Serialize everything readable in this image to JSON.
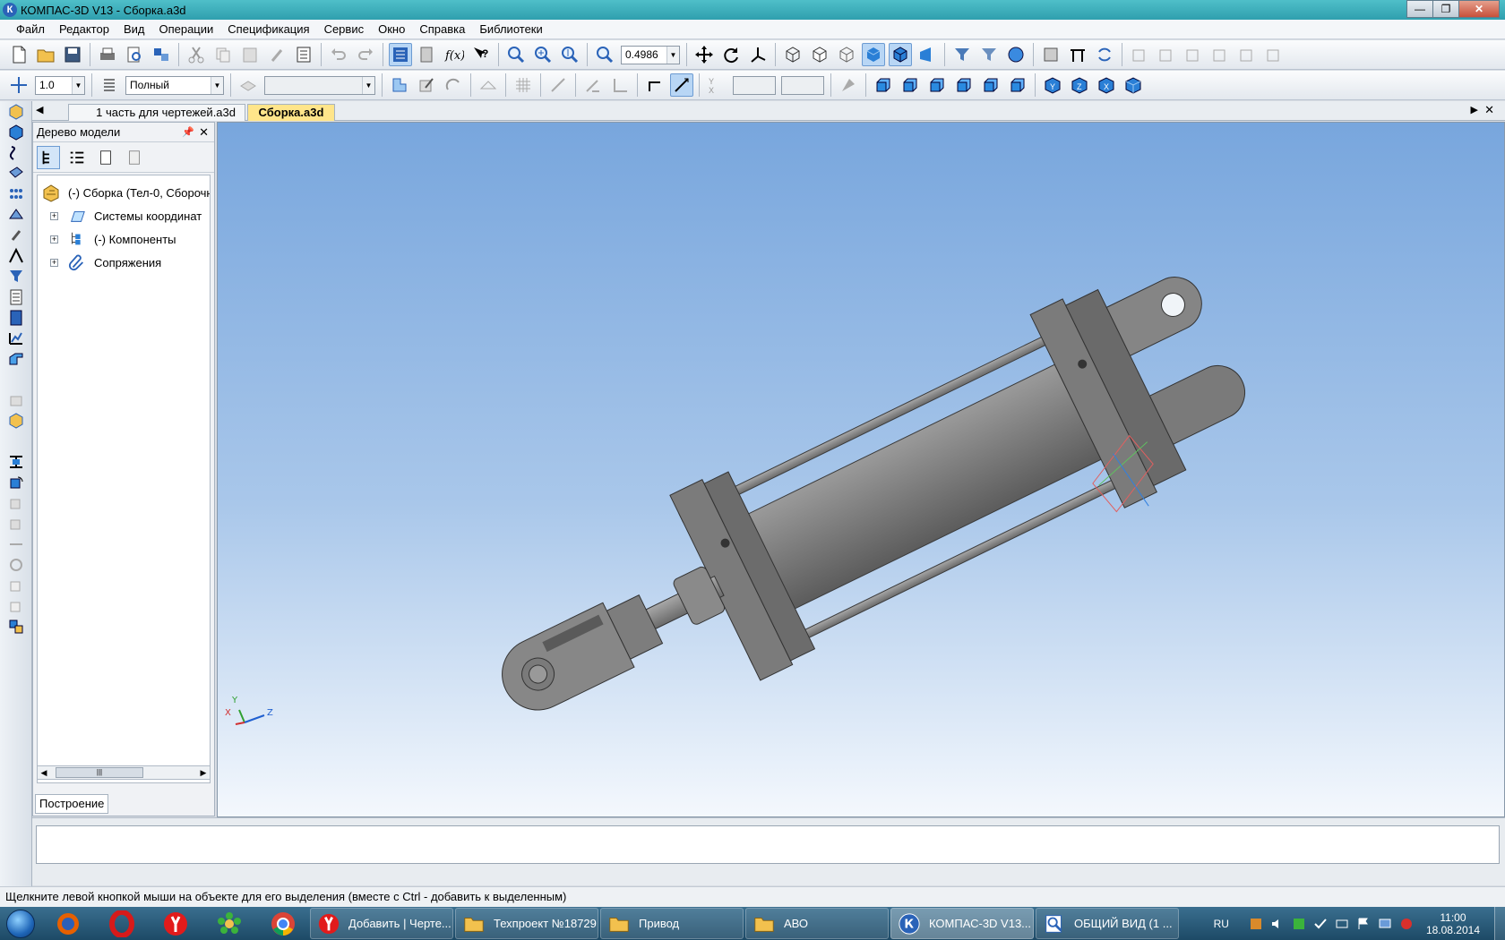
{
  "window": {
    "title": "КОМПАС-3D V13 - Сборка.a3d",
    "app_icon": "К"
  },
  "window_buttons": {
    "minimize": "—",
    "maximize": "❐",
    "close": "✕"
  },
  "menu": [
    "Файл",
    "Редактор",
    "Вид",
    "Операции",
    "Спецификация",
    "Сервис",
    "Окно",
    "Справка",
    "Библиотеки"
  ],
  "toolbar1": {
    "zoom_value": "0.4986"
  },
  "toolbar2": {
    "step_value": "1.0",
    "style_value": "Полный",
    "layer_value": ""
  },
  "doc_tabs": [
    {
      "label": "1 часть для чертежей.a3d",
      "active": false
    },
    {
      "label": "Сборка.a3d",
      "active": true
    }
  ],
  "tree": {
    "header": "Дерево модели",
    "root": "(-) Сборка (Тел-0, Сборочн",
    "items": [
      "Системы координат",
      "(-) Компоненты",
      "Сопряжения"
    ],
    "bottom_tab": "Построение"
  },
  "viewport": {
    "axes_labels": {
      "x": "X",
      "y": "Y",
      "z": "Z"
    }
  },
  "status": {
    "hint": "Щелкните левой кнопкой мыши на объекте для его выделения (вместе с Ctrl - добавить к выделенным)"
  },
  "taskbar": {
    "tasks": [
      {
        "label": "Добавить | Черте...",
        "icon": "yandex-icon"
      },
      {
        "label": "Техпроект №18729",
        "icon": "folder-icon"
      },
      {
        "label": "Привод",
        "icon": "folder-icon"
      },
      {
        "label": "АВО",
        "icon": "folder-icon"
      },
      {
        "label": "КОМПАС-3D V13...",
        "icon": "kompas-icon",
        "active": true
      },
      {
        "label": "ОБЩИЙ ВИД (1 ...",
        "icon": "drawing-icon"
      }
    ],
    "lang": "RU",
    "time": "11:00",
    "date": "18.08.2014"
  },
  "colors": {
    "title_bar": "#3aaebb",
    "viewport_top": "#78a6dd",
    "active_tab": "#ffe58a",
    "part_gray": "#8d8d8d"
  }
}
